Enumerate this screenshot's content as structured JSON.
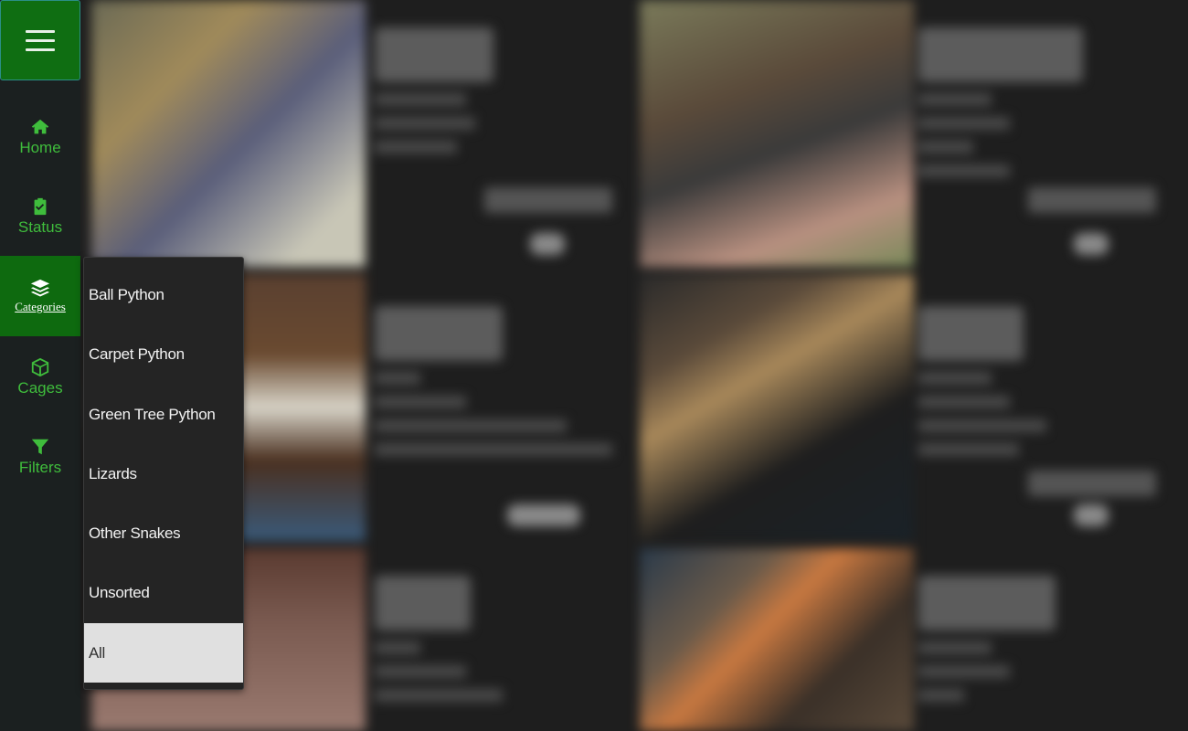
{
  "sidebar": {
    "menu_button": "menu",
    "items": [
      {
        "label": "Home",
        "icon": "home-icon"
      },
      {
        "label": "Status",
        "icon": "clipboard-check-icon"
      },
      {
        "label": "Categories",
        "icon": "layers-icon"
      },
      {
        "label": "Cages",
        "icon": "box-icon"
      },
      {
        "label": "Filters",
        "icon": "filter-icon"
      }
    ],
    "active": "Categories",
    "accent_color": "#3fbd3c",
    "active_bg": "#0e6a0f"
  },
  "categories_dropdown": {
    "options": [
      "Ball Python",
      "Carpet Python",
      "Green Tree Python",
      "Lizards",
      "Other Snakes",
      "Unsorted",
      "All"
    ],
    "selected": "All"
  }
}
